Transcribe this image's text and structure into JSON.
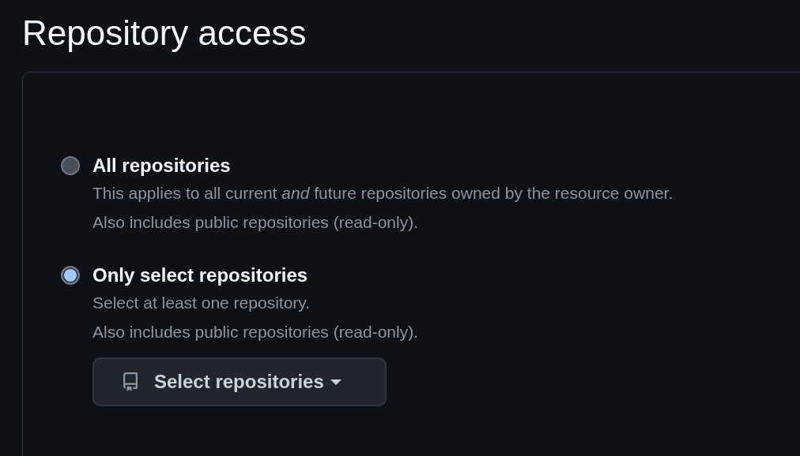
{
  "title": "Repository access",
  "options": [
    {
      "label": "All repositories",
      "selected": false,
      "description": [
        "This applies to all current *and* future repositories owned by the resource owner.",
        "Also includes public repositories (read-only)."
      ]
    },
    {
      "label": "Only select repositories",
      "selected": true,
      "description": [
        "Select at least one repository.",
        "Also includes public repositories (read-only)."
      ],
      "button": {
        "label": "Select repositories"
      }
    }
  ]
}
